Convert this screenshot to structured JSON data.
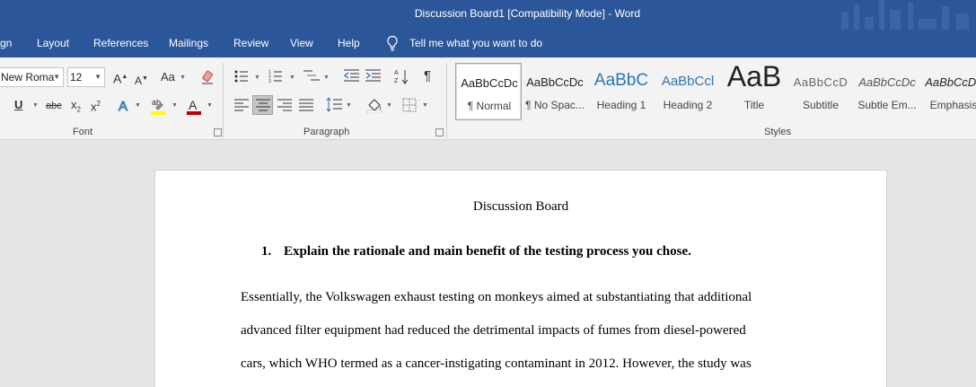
{
  "window": {
    "title": "Discussion Board1 [Compatibility Mode]  -  Word"
  },
  "tabs": [
    {
      "label": "gn"
    },
    {
      "label": "Layout"
    },
    {
      "label": "References"
    },
    {
      "label": "Mailings"
    },
    {
      "label": "Review"
    },
    {
      "label": "View"
    },
    {
      "label": "Help"
    }
  ],
  "tell_me": {
    "placeholder": "Tell me what you want to do",
    "icon": "lightbulb-icon"
  },
  "font_group": {
    "label": "Font",
    "font_name": "New Roma",
    "font_size": "12",
    "grow_label": "A",
    "shrink_label": "A",
    "case_label": "Aa",
    "underline_label": "U",
    "strike_label": "abc",
    "subscript_label": "x",
    "superscript_label": "x",
    "highlight_color": "#ffff00",
    "font_color": "#c00000"
  },
  "paragraph_group": {
    "label": "Paragraph",
    "pilcrow": "¶"
  },
  "styles_group": {
    "label": "Styles",
    "items": [
      {
        "sample": "AaBbCcDc",
        "name": "¶ Normal"
      },
      {
        "sample": "AaBbCcDc",
        "name": "¶ No Spac..."
      },
      {
        "sample": "AaBbC",
        "name": "Heading 1"
      },
      {
        "sample": "AaBbCcl",
        "name": "Heading 2"
      },
      {
        "sample": "AaB",
        "name": "Title"
      },
      {
        "sample": "AaBbCcD",
        "name": "Subtitle"
      },
      {
        "sample": "AaBbCcDc",
        "name": "Subtle Em..."
      },
      {
        "sample": "AaBbCcDc",
        "name": "Emphasis"
      }
    ]
  },
  "document": {
    "title": "Discussion Board",
    "question_number": "1.",
    "question": "Explain the rationale and main benefit of the testing process you chose.",
    "lines": [
      "Essentially, the Volkswagen exhaust testing on monkeys aimed at substantiating that additional",
      "advanced filter equipment had reduced the detrimental impacts of fumes from diesel-powered",
      "cars, which WHO termed as a cancer-instigating contaminant in 2012. However, the study was"
    ]
  }
}
